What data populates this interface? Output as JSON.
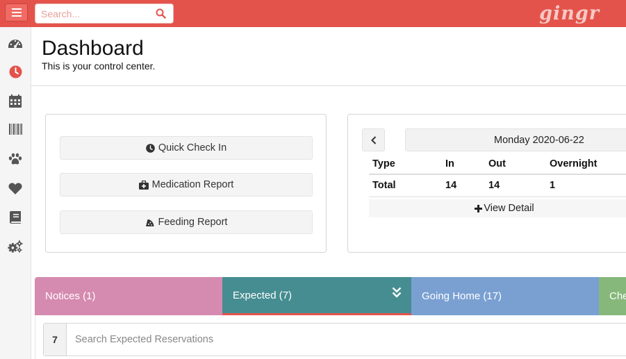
{
  "topbar": {
    "search_placeholder": "Search...",
    "logo_text": "gingr",
    "accent_color": "#e4534b"
  },
  "sidebar": {
    "items": [
      {
        "icon": "speedometer-icon"
      },
      {
        "icon": "clock-icon",
        "active": true
      },
      {
        "icon": "calendar-icon"
      },
      {
        "icon": "barcode-icon"
      },
      {
        "icon": "paw-icon"
      },
      {
        "icon": "heart-icon"
      },
      {
        "icon": "book-icon"
      },
      {
        "icon": "gears-icon"
      }
    ]
  },
  "header": {
    "title": "Dashboard",
    "subtitle": "This is your control center."
  },
  "actions": {
    "quick_check_in": "Quick Check In",
    "medication_report": "Medication Report",
    "feeding_report": "Feeding Report"
  },
  "counts": {
    "date_label": "Monday 2020-06-22",
    "columns": [
      "Type",
      "In",
      "Out",
      "Overnight"
    ],
    "total_row": {
      "type": "Total",
      "in": "14",
      "out": "14",
      "overnight": "1"
    },
    "view_detail": "View Detail"
  },
  "tabs": {
    "notices": "Notices (1)",
    "expected": "Expected (7)",
    "going_home": "Going Home (17)",
    "checked_in": "Che",
    "colors": {
      "notices": "#d58ab0",
      "expected": "#468d91",
      "going_home": "#7aa0d2",
      "checked_in": "#86b87b"
    }
  },
  "reservations": {
    "count": "7",
    "search_placeholder": "Search Expected Reservations"
  }
}
